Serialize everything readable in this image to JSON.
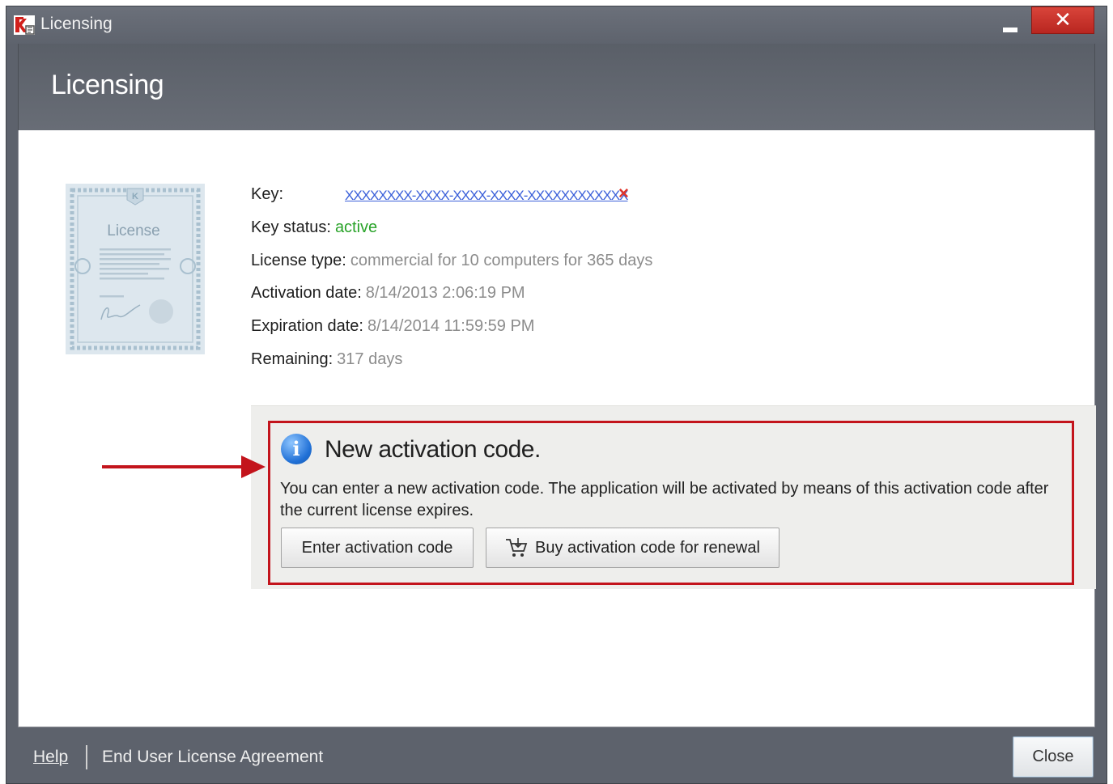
{
  "window": {
    "title": "Licensing"
  },
  "titlebar": {
    "minimize_label": "",
    "close_symbol": "✕"
  },
  "header": {
    "title": "Licensing"
  },
  "license_image": {
    "caption": "License"
  },
  "key_info": {
    "key_label": "Key:",
    "key_value": "XXXXXXXX-XXXX-XXXX-XXXX-XXXXXXXXXXXX",
    "remove_symbol": "×",
    "status_label": "Key status:",
    "status_value": "active",
    "type_label": "License type:",
    "type_value": "commercial for 10 computers for 365 days",
    "activation_label": "Activation date:",
    "activation_value": "8/14/2013 2:06:19 PM",
    "expiration_label": "Expiration date:",
    "expiration_value": "8/14/2014 11:59:59 PM",
    "remaining_label": "Remaining:",
    "remaining_value": "317 days"
  },
  "notice": {
    "icon_glyph": "i",
    "title": "New activation code.",
    "description": "You can enter a new activation code. The application will be activated by means of this activation code after the current license expires.",
    "enter_button": "Enter activation code",
    "buy_button": "Buy activation code for renewal"
  },
  "footer": {
    "help": "Help",
    "eula": "End User License Agreement",
    "close_button": "Close"
  },
  "colors": {
    "accent_red": "#c3141c",
    "status_green": "#29a329",
    "link_blue": "#3a5fd9"
  }
}
